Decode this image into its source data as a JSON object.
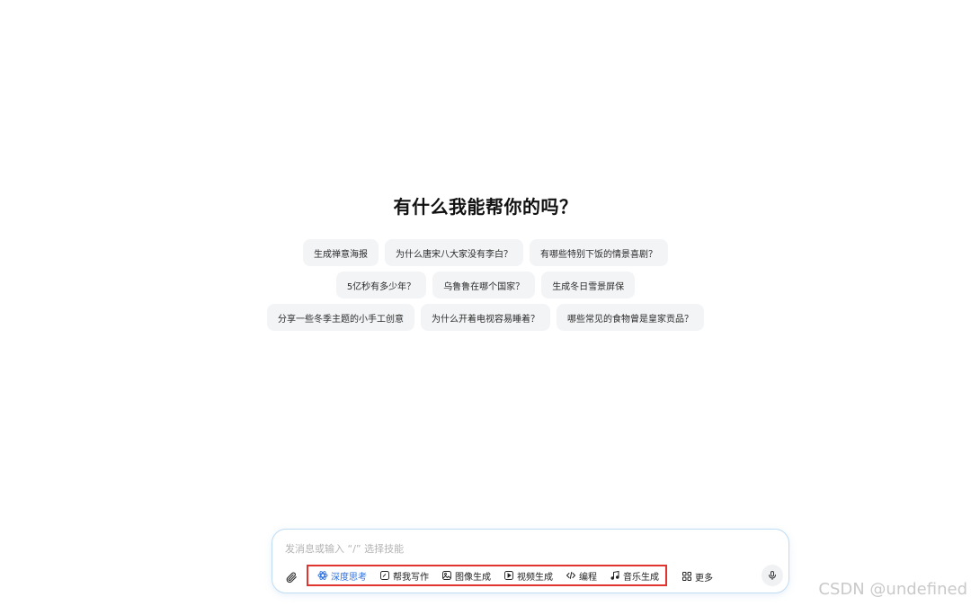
{
  "main": {
    "title": "有什么我能帮你的吗？",
    "suggestions": [
      [
        "生成禅意海报",
        "为什么唐宋八大家没有李白？",
        "有哪些特别下饭的情景喜剧？"
      ],
      [
        "5亿秒有多少年？",
        "乌鲁鲁在哪个国家？",
        "生成冬日雪景屏保"
      ],
      [
        "分享一些冬季主题的小手工创意",
        "为什么开着电视容易睡着？",
        "哪些常见的食物曾是皇家贡品？"
      ]
    ]
  },
  "composer": {
    "placeholder": "发消息或输入 “/” 选择技能",
    "skills": [
      {
        "label": "深度思考",
        "icon": "atom-icon",
        "active": true
      },
      {
        "label": "帮我写作",
        "icon": "pen-icon",
        "active": false
      },
      {
        "label": "图像生成",
        "icon": "image-icon",
        "active": false
      },
      {
        "label": "视频生成",
        "icon": "video-icon",
        "active": false
      },
      {
        "label": "编程",
        "icon": "code-icon",
        "active": false
      },
      {
        "label": "音乐生成",
        "icon": "music-icon",
        "active": false
      }
    ],
    "more_label": "更多",
    "accent_color": "#2a6fe0",
    "highlight_color": "#e2342f"
  },
  "watermark": "CSDN @undefined"
}
